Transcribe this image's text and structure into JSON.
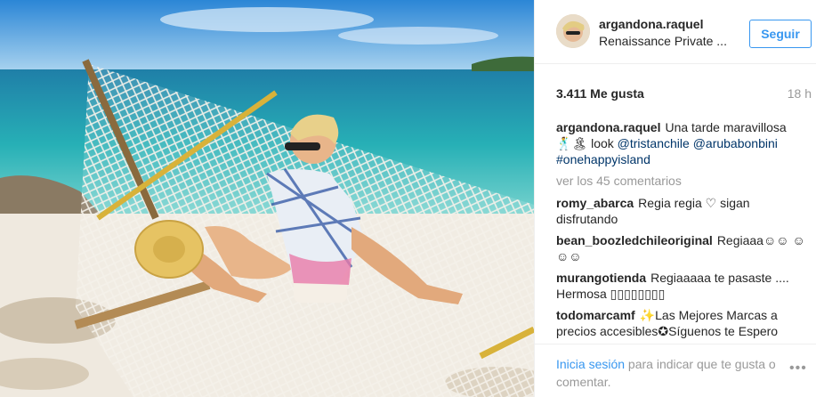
{
  "post": {
    "username": "argandona.raquel",
    "location": "Renaissance Private ...",
    "follow_label": "Seguir",
    "likes": "3.411 Me gusta",
    "time": "18 h",
    "caption": {
      "user": "argandona.raquel",
      "text_1": "Una tarde maravillosa",
      "text_2": "🕺🏝 look ",
      "tag_1": "@tristanchile",
      "tag_2": "@arubabonbini",
      "tag_3": "#onehappyisland"
    },
    "view_all": "ver los 45 comentarios",
    "comments": [
      {
        "user": "romy_abarca",
        "text": "Regia regia ♡ sigan disfrutando"
      },
      {
        "user": "bean_boozledchileoriginal",
        "text": "Regiaaa☺☺ ☺☺☺"
      },
      {
        "user": "murangotienda",
        "text": "Regiaaaaa te pasaste .... Hermosa ▯▯▯▯▯▯▯▯"
      },
      {
        "user": "todomarcamf",
        "text": "✨Las Mejores Marcas a precios accesibles✪Síguenos te Espero"
      }
    ],
    "login_link": "Inicia sesión",
    "login_rest": " para indicar que te gusta o comentar.",
    "more_icon": "ellipsis-icon"
  },
  "colors": {
    "accent": "#3897f0",
    "tag": "#003569",
    "muted": "#999999"
  }
}
